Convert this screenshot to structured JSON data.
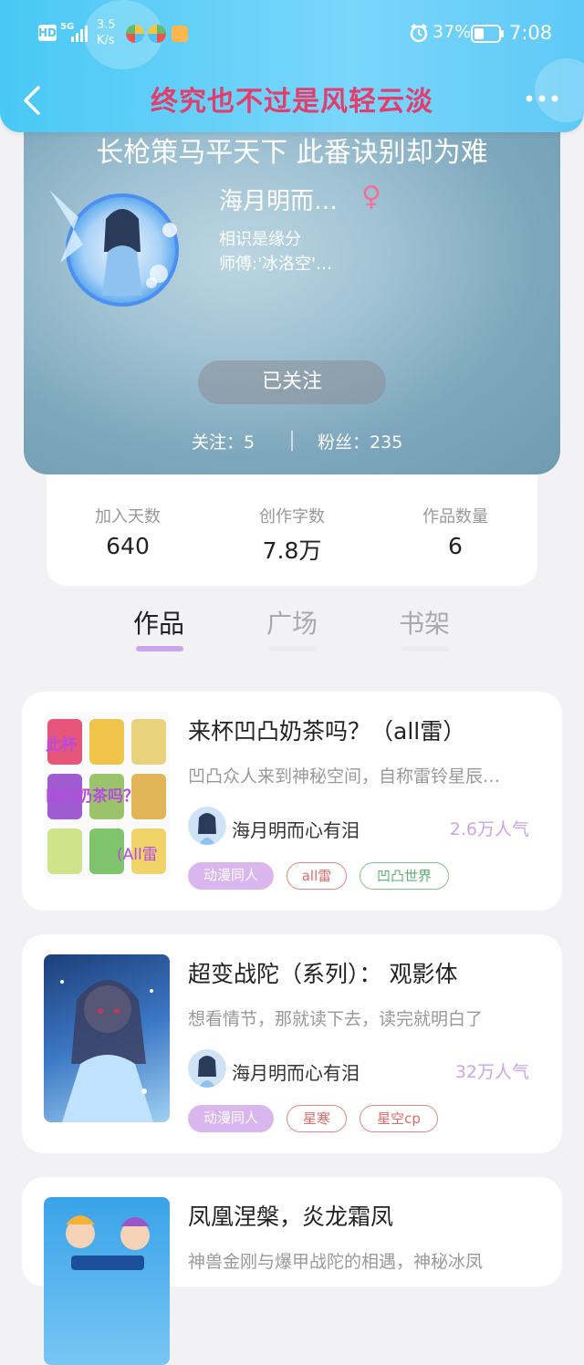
{
  "status": {
    "net_speed": "3.5",
    "net_unit": "K/s",
    "signal": "5G",
    "hd": "HD",
    "battery": "37%",
    "time": "7:08"
  },
  "header": {
    "title": "终究也不过是风轻云淡"
  },
  "profile": {
    "signature": "长枪策马平天下 此番诀别却为难",
    "nickname": "海月明而…",
    "gender": "♀",
    "bio_line1": "相识是缘分",
    "bio_line2": "师傅:'冰洛空'…",
    "follow_button": "已关注",
    "following_label": "关注：",
    "following_count": "5",
    "fans_label": "粉丝：",
    "fans_count": "235"
  },
  "stats": [
    {
      "label": "加入天数",
      "value": "640"
    },
    {
      "label": "创作字数",
      "value": "7.8万"
    },
    {
      "label": "作品数量",
      "value": "6"
    }
  ],
  "tabs": [
    {
      "label": "作品",
      "active": true
    },
    {
      "label": "广场",
      "active": false
    },
    {
      "label": "书架",
      "active": false
    }
  ],
  "works": [
    {
      "title": "来杯凹凸奶茶吗？（all雷）",
      "desc": "凹凸众人来到神秘空间，自称雷铃星辰…",
      "author": "海月明而心有泪",
      "popularity": "2.6万人气",
      "cover_text": [
        "此杯",
        "凹凸奶茶吗？",
        "(All雷"
      ],
      "tags": [
        {
          "label": "动漫同人",
          "style": "filled"
        },
        {
          "label": "all雷",
          "style": "red"
        },
        {
          "label": "凹凸世界",
          "style": "green"
        }
      ]
    },
    {
      "title": "超变战陀（系列）： 观影体",
      "desc": "想看情节，那就读下去，读完就明白了",
      "author": "海月明而心有泪",
      "popularity": "32万人气",
      "tags": [
        {
          "label": "动漫同人",
          "style": "filled"
        },
        {
          "label": "星寒",
          "style": "red"
        },
        {
          "label": "星空cp",
          "style": "red"
        }
      ]
    },
    {
      "title": "凤凰涅槃，炎龙霜凤",
      "desc": "神兽金刚与爆甲战陀的相遇，神秘冰凤",
      "tags": []
    }
  ],
  "colors": {
    "accent": "#49c8f5",
    "title": "#e23d6c",
    "tag_filled": "#d9b6ee",
    "popularity": "#c9a6ec"
  }
}
